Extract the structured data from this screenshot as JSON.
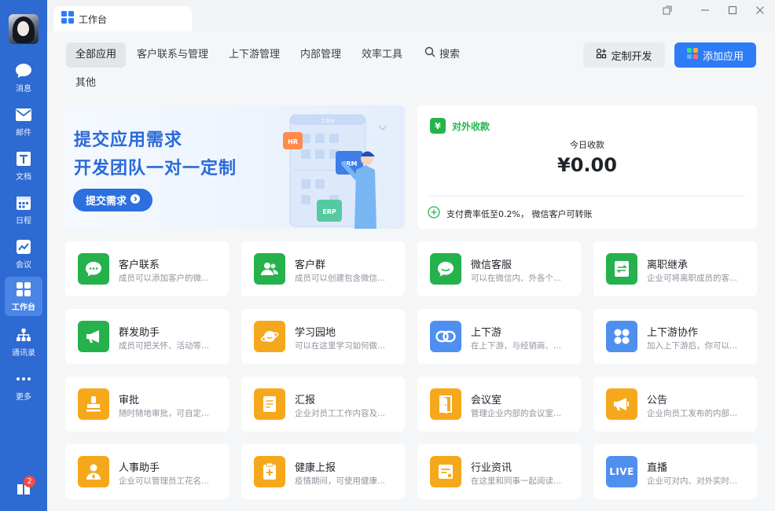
{
  "sidebar": {
    "items": [
      {
        "key": "messages",
        "label": "消息",
        "icon": "chat-bubble-icon"
      },
      {
        "key": "mail",
        "label": "邮件",
        "icon": "envelope-icon"
      },
      {
        "key": "docs",
        "label": "文档",
        "icon": "document-icon"
      },
      {
        "key": "schedule",
        "label": "日程",
        "icon": "calendar-icon"
      },
      {
        "key": "meeting",
        "label": "会议",
        "icon": "meeting-icon"
      },
      {
        "key": "workbench",
        "label": "工作台",
        "icon": "grid-icon",
        "active": true
      },
      {
        "key": "contacts",
        "label": "通讯录",
        "icon": "org-chart-icon"
      },
      {
        "key": "more",
        "label": "更多",
        "icon": "ellipsis-icon"
      }
    ],
    "bottom_badge": "2"
  },
  "tab": {
    "title": "工作台",
    "icon": "grid-icon"
  },
  "window": {
    "controls": [
      "popout-icon",
      "minimize-icon",
      "maximize-icon",
      "close-icon"
    ]
  },
  "categories": [
    "全部应用",
    "客户联系与管理",
    "上下游管理",
    "内部管理",
    "效率工具",
    "搜索",
    "其他"
  ],
  "actions": {
    "custom_dev": "定制开发",
    "add_app": "添加应用"
  },
  "banner": {
    "line1": "提交应用需求",
    "line2": "开发团队一对一定制",
    "cta": "提交需求",
    "illustration_title": "工作台",
    "tags": [
      "HR",
      "CRM",
      "ERP"
    ]
  },
  "payments": {
    "title": "对外收款",
    "today_label": "今日收款",
    "amount": "¥0.00",
    "note": "支付费率低至0.2%， 微信客户可转账"
  },
  "apps": [
    {
      "name": "客户联系",
      "desc": "成员可以添加客户的微...",
      "color": "#25b24d",
      "icon": "chat-dots-icon"
    },
    {
      "name": "客户群",
      "desc": "成员可以创建包含微信...",
      "color": "#25b24d",
      "icon": "people-icon"
    },
    {
      "name": "微信客服",
      "desc": "可以在微信内、外各个...",
      "color": "#25b24d",
      "icon": "customer-service-icon"
    },
    {
      "name": "离职继承",
      "desc": "企业可将离职成员的客...",
      "color": "#25b24d",
      "icon": "transfer-icon"
    },
    {
      "name": "群发助手",
      "desc": "成员可把关怀、活动等...",
      "color": "#25b24d",
      "icon": "megaphone-icon"
    },
    {
      "name": "学习园地",
      "desc": "可以在这里学习如何做...",
      "color": "#f6a81c",
      "icon": "planet-icon"
    },
    {
      "name": "上下游",
      "desc": "在上下游，与经销商、...",
      "color": "#4f8ff0",
      "icon": "link-icon"
    },
    {
      "name": "上下游协作",
      "desc": "加入上下游后，你可以...",
      "color": "#4f8ff0",
      "icon": "four-dots-icon"
    },
    {
      "name": "审批",
      "desc": "随时随地审批，可自定...",
      "color": "#f6a81c",
      "icon": "stamp-icon"
    },
    {
      "name": "汇报",
      "desc": "企业对员工工作内容及...",
      "color": "#f6a81c",
      "icon": "report-icon"
    },
    {
      "name": "会议室",
      "desc": "管理企业内部的会议室...",
      "color": "#f6a81c",
      "icon": "door-icon"
    },
    {
      "name": "公告",
      "desc": "企业向员工发布的内部...",
      "color": "#f6a81c",
      "icon": "announcement-icon"
    },
    {
      "name": "人事助手",
      "desc": "企业可以管理员工花名...",
      "color": "#f6a81c",
      "icon": "person-icon"
    },
    {
      "name": "健康上报",
      "desc": "疫情期间，可使用健康...",
      "color": "#f6a81c",
      "icon": "health-clipboard-icon"
    },
    {
      "name": "行业资讯",
      "desc": "在这里和同事一起阅读...",
      "color": "#f6a81c",
      "icon": "news-icon"
    },
    {
      "name": "直播",
      "desc": "企业可对内、对外实时...",
      "color": "#4f8ff0",
      "icon": "live-icon",
      "icon_text": "LIVE"
    }
  ]
}
